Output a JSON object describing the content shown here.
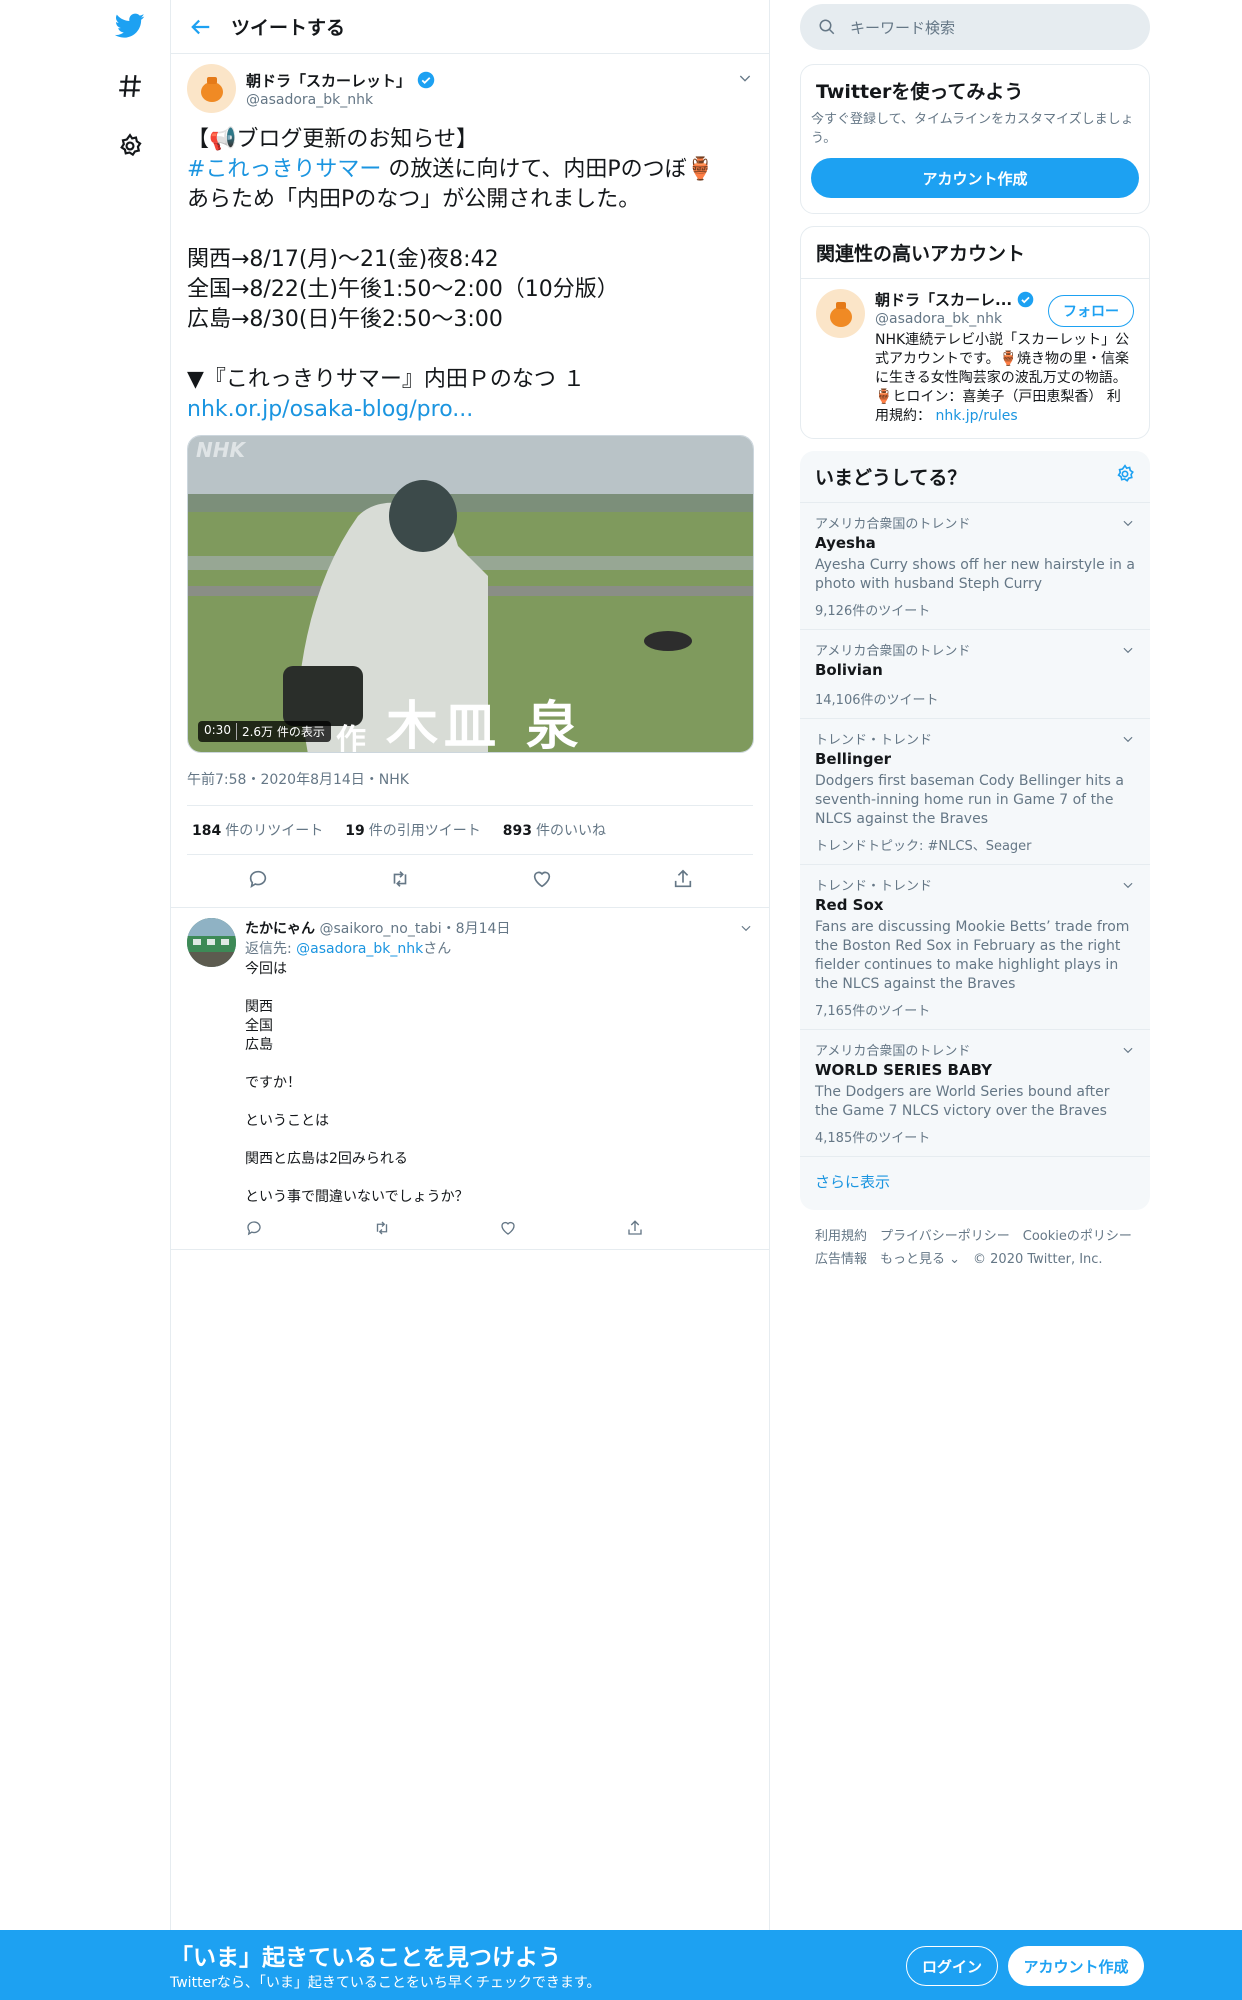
{
  "header": {
    "title": "ツイートする"
  },
  "tweet": {
    "name": "朝ドラ「スカーレット」",
    "handle": "@asadora_bk_nhk",
    "line1": "【📢ブログ更新のお知らせ】",
    "hashtag": "#これっきりサマー",
    "line2a": " の放送に向けて、内田Pのつぼ🏺",
    "line2b": "あらため「内田Pのなつ」が公開されました。",
    "schedule": "関西→8/17(月)～21(金)夜8:42\n全国→8/22(土)午後1:50～2:00（10分版）\n広島→8/30(日)午後2:50～3:00",
    "line3": "▼『これっきりサマー』内田Ｐのなつ １",
    "link": "nhk.or.jp/osaka-blog/pro...",
    "media": {
      "duration": "0:30",
      "views": "2.6万 件の表示",
      "watermark": "NHK",
      "caption_small": "作",
      "caption": "木皿 泉"
    },
    "meta": "午前7:58・2020年8月14日・NHK",
    "retweets": "184",
    "retweets_label": "件のリツイート",
    "quotes": "19",
    "quotes_label": "件の引用ツイート",
    "likes": "893",
    "likes_label": "件のいいね"
  },
  "reply": {
    "name": "たかにゃん",
    "handle": "@saikoro_no_tabi",
    "date": "・8月14日",
    "to_prefix": "返信先: ",
    "to_handle": "@asadora_bk_nhk",
    "to_suffix": "さん",
    "text": "今回は\n\n関西\n全国\n広島\n\nですか！\n\nということは\n\n関西と広島は2回みられる\n\nという事で間違いないでしょうか？"
  },
  "right": {
    "search_placeholder": "キーワード検索",
    "signup_title": "Twitterを使ってみよう",
    "signup_desc": "今すぐ登録して、タイムラインをカスタマイズしましょう。",
    "signup_button": "アカウント作成",
    "related_title": "関連性の高いアカウント",
    "related_name": "朝ドラ「スカーレ...",
    "related_handle": "@asadora_bk_nhk",
    "follow": "フォロー",
    "related_bio": "NHK連続テレビ小説「スカーレット」公式アカウントです。🏺焼き物の里・信楽に生きる女性陶芸家の波乱万丈の物語。🏺ヒロイン：喜美子（戸田恵梨香） 利用規約：",
    "related_link": "nhk.jp/rules",
    "trends_title": "いまどうしてる？",
    "trends": [
      {
        "context": "アメリカ合衆国のトレンド",
        "name": "Ayesha",
        "desc": "Ayesha Curry shows off her new hairstyle in a photo with husband Steph Curry",
        "stat": "9,126件のツイート"
      },
      {
        "context": "アメリカ合衆国のトレンド",
        "name": "Bolivian",
        "desc": "",
        "stat": "14,106件のツイート"
      },
      {
        "context": "トレンド・トレンド",
        "name": "Bellinger",
        "desc": "Dodgers first baseman Cody Bellinger hits a seventh-inning home run in Game 7 of the NLCS against the Braves",
        "stat": "トレンドトピック: #NLCS、Seager"
      },
      {
        "context": "トレンド・トレンド",
        "name": "Red Sox",
        "desc": "Fans are discussing Mookie Betts’ trade from the Boston Red Sox in February as the right fielder continues to make highlight plays in the NLCS against the Braves",
        "stat": "7,165件のツイート"
      },
      {
        "context": "アメリカ合衆国のトレンド",
        "name": "WORLD SERIES BABY",
        "desc": "The Dodgers are World Series bound after the Game 7 NLCS victory over the Braves",
        "stat": "4,185件のツイート"
      }
    ],
    "show_more": "さらに表示",
    "footer_line1": "利用規約　プライバシーポリシー　Cookieのポリシー",
    "footer_line2": "広告情報　もっと見る ⌄　© 2020 Twitter, Inc."
  },
  "banner": {
    "title": "「いま」起きていることを見つけよう",
    "subtitle": "Twitterなら、「いま」起きていることをいち早くチェックできます。",
    "login": "ログイン",
    "signup": "アカウント作成"
  },
  "colors": {
    "accent": "#1da1f2",
    "link": "#1b95e0",
    "muted": "#657786"
  }
}
